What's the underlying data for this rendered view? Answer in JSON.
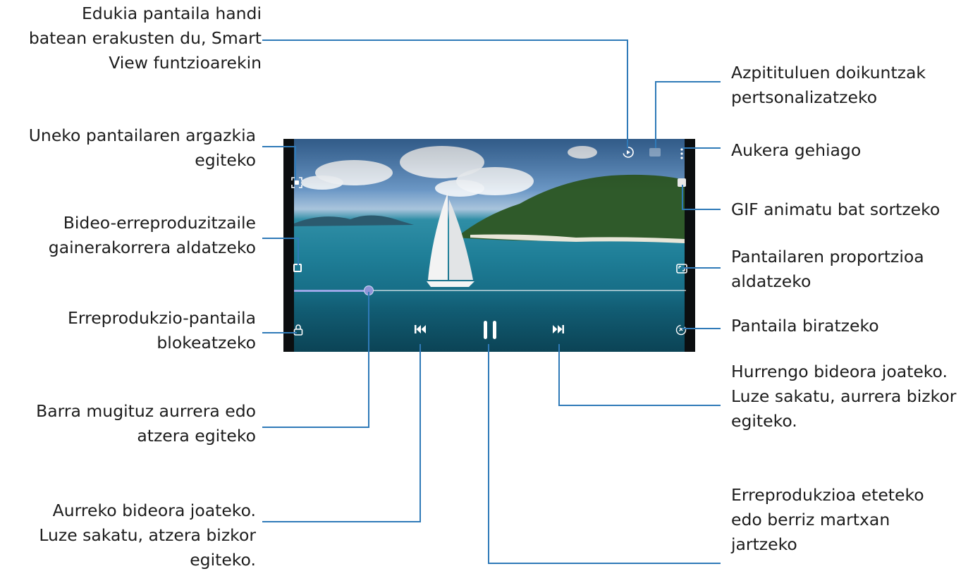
{
  "callouts": {
    "smart_view": [
      "Edukia pantaila handi",
      "batean erakusten du, Smart",
      "View funtzioarekin"
    ],
    "screenshot": [
      "Uneko pantailaren argazkia",
      "egiteko"
    ],
    "popup_player": [
      "Bideo-erreproduzitzaile",
      "gainerakorrera aldatzeko"
    ],
    "lock": [
      "Erreprodukzio-pantaila",
      "blokeatzeko"
    ],
    "seek_bar": [
      "Barra mugituz aurrera edo",
      "atzera egiteko"
    ],
    "previous": [
      "Aurreko bideora joateko.",
      "Luze sakatu, atzera bizkor",
      "egiteko."
    ],
    "subtitles": [
      "Azpitituluen doikuntzak",
      "pertsonalizatzeko"
    ],
    "more_options": [
      "Aukera gehiago"
    ],
    "gif": [
      "GIF animatu bat sortzeko"
    ],
    "ratio": [
      "Pantailaren proportzioa",
      "aldatzeko"
    ],
    "rotate": [
      "Pantaila biratzeko"
    ],
    "next": [
      "Hurrengo bideora joateko.",
      "Luze sakatu, aurrera bizkor",
      "egiteko."
    ],
    "pause": [
      "Erreprodukzioa eteteko",
      "edo berriz martxan",
      "jartzeko"
    ]
  },
  "player": {
    "seek_progress": 0.19,
    "icons": [
      "screenshot-icon",
      "popup-player-icon",
      "lock-icon",
      "smart-view-icon",
      "subtitle-icon",
      "more-options-icon",
      "gif-icon",
      "aspect-ratio-icon",
      "rotate-icon",
      "previous-icon",
      "pause-icon",
      "next-icon"
    ]
  },
  "colors": {
    "leader_line": "#2f7ab8",
    "text": "#1c1c1c"
  }
}
